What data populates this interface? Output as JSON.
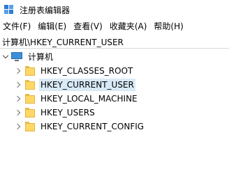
{
  "window": {
    "title": "注册表编辑器"
  },
  "menu": [
    "文件(F)",
    "编辑(E)",
    "查看(V)",
    "收藏夹(A)",
    "帮助(H)"
  ],
  "address": "计算机\\HKEY_CURRENT_USER",
  "tree": {
    "root": {
      "label": "计算机",
      "expanded": true
    },
    "children": [
      {
        "label": "HKEY_CLASSES_ROOT",
        "selected": false
      },
      {
        "label": "HKEY_CURRENT_USER",
        "selected": true
      },
      {
        "label": "HKEY_LOCAL_MACHINE",
        "selected": false
      },
      {
        "label": "HKEY_USERS",
        "selected": false
      },
      {
        "label": "HKEY_CURRENT_CONFIG",
        "selected": false
      }
    ]
  },
  "colors": {
    "selection": "#d9eaf7",
    "folder": "#ffd764",
    "accent": "#2f7bd4"
  }
}
